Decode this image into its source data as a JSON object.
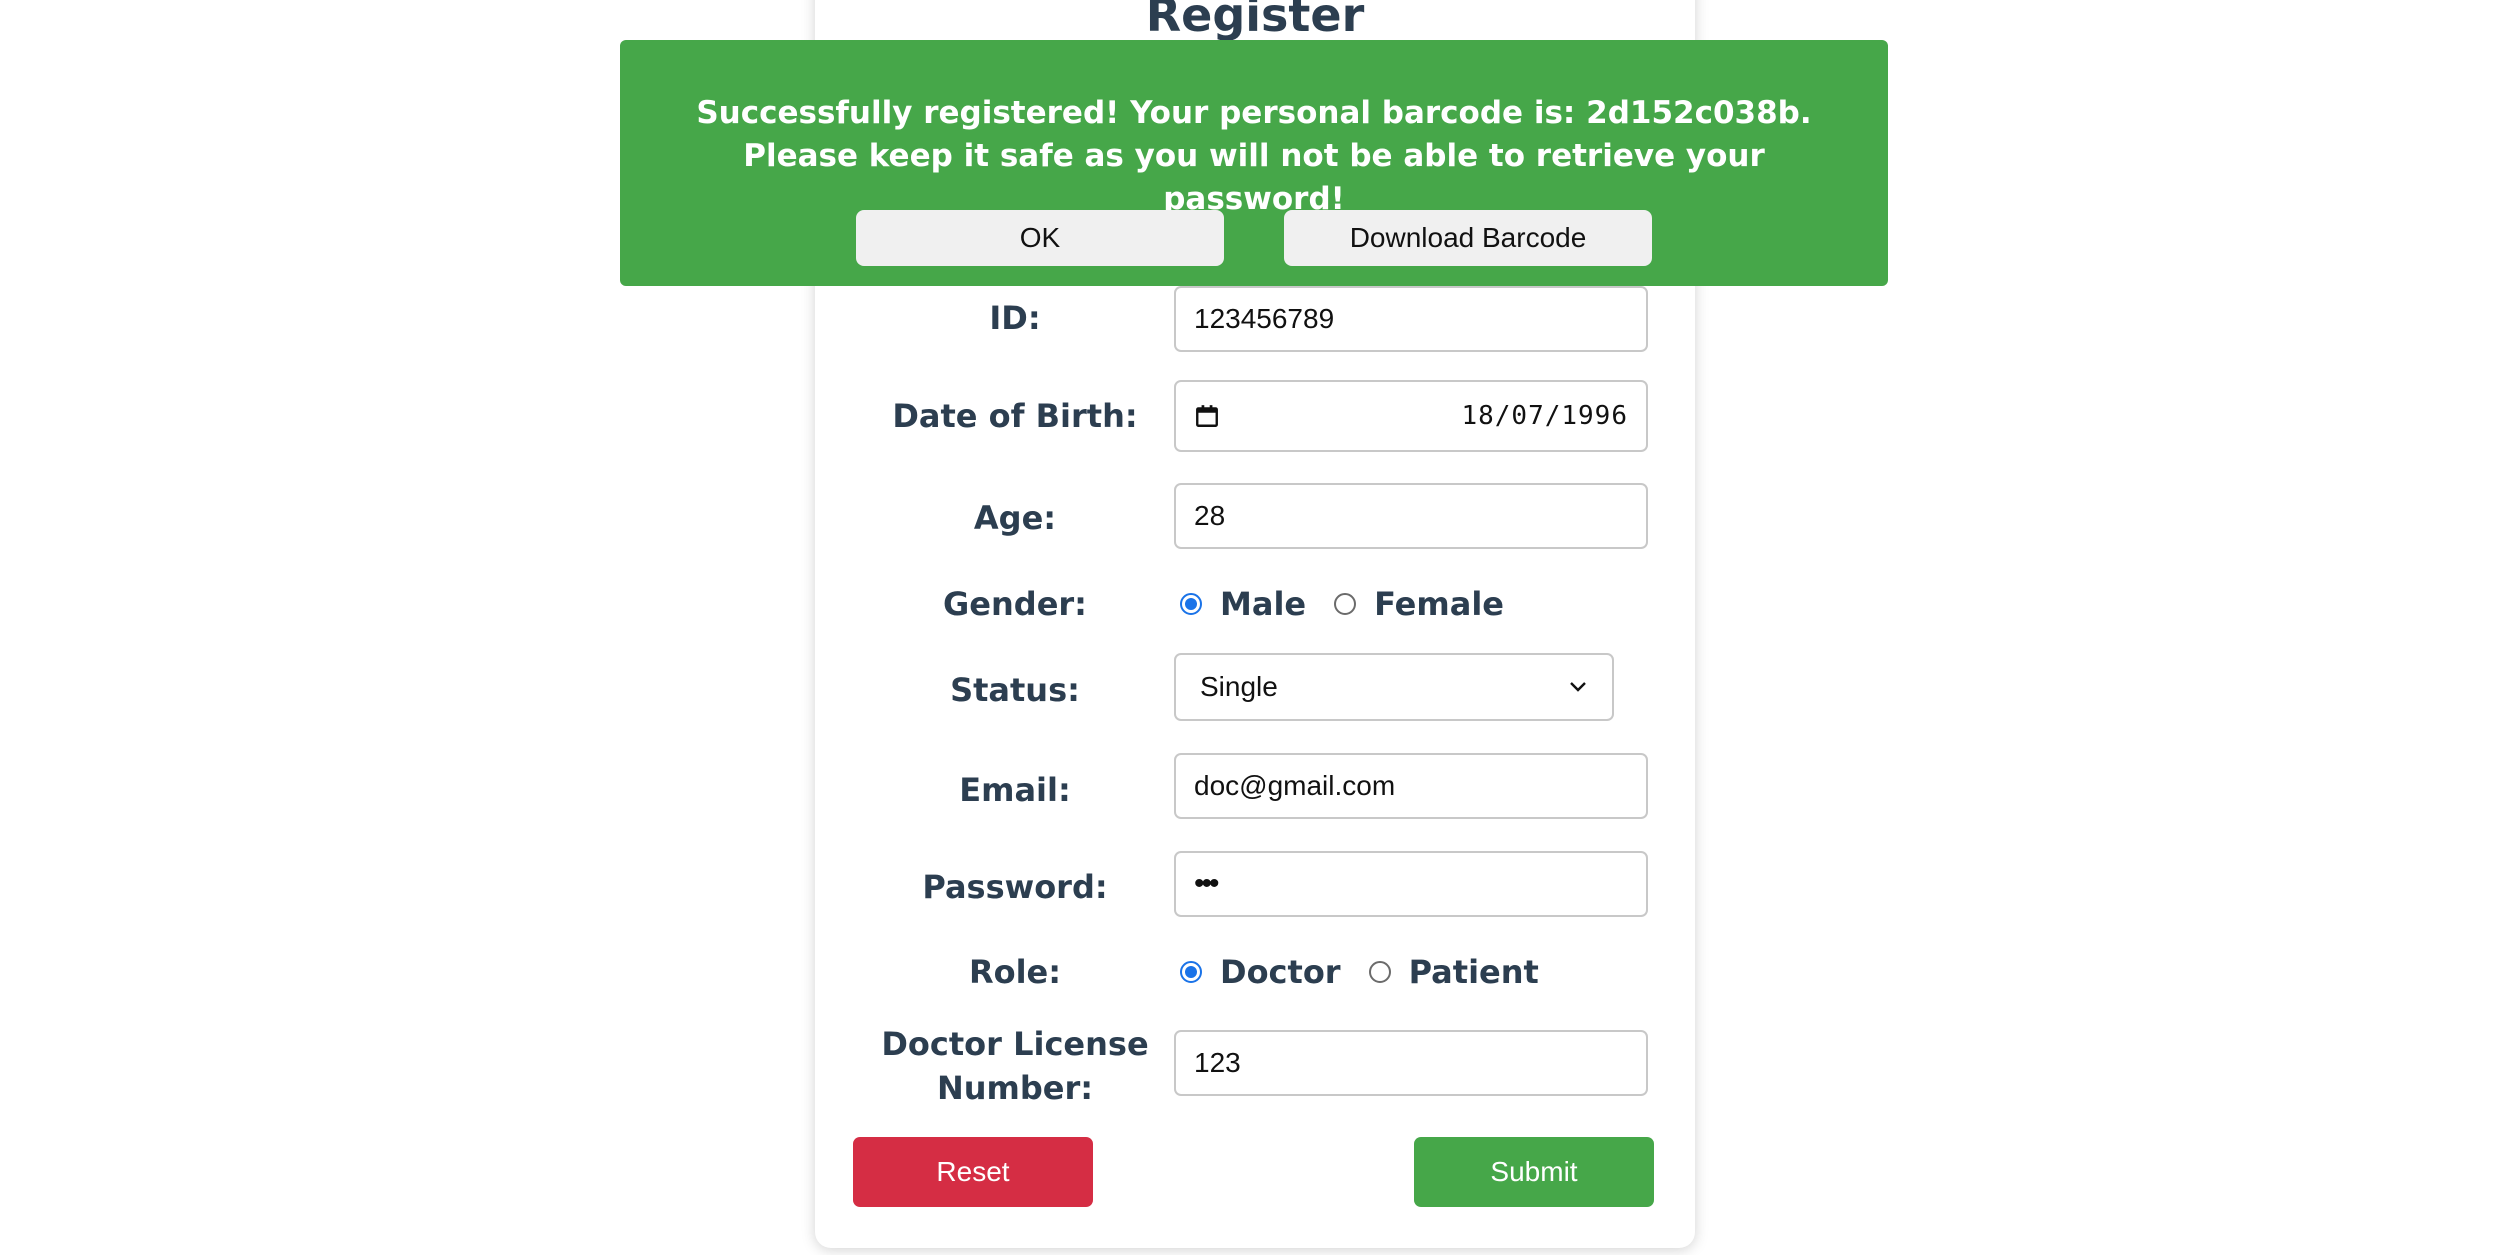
{
  "form": {
    "title": "Register",
    "fields": {
      "id": {
        "label": "ID:",
        "value": "123456789"
      },
      "dob": {
        "label": "Date of Birth:",
        "value": "18/07/1996"
      },
      "age": {
        "label": "Age:",
        "value": "28"
      },
      "gender": {
        "label": "Gender:",
        "options": [
          "Male",
          "Female"
        ],
        "selected": "Male"
      },
      "status": {
        "label": "Status:",
        "value": "Single"
      },
      "email": {
        "label": "Email:",
        "value": "doc@gmail.com"
      },
      "password": {
        "label": "Password:",
        "masked": "•••"
      },
      "role": {
        "label": "Role:",
        "options": [
          "Doctor",
          "Patient"
        ],
        "selected": "Doctor"
      },
      "license": {
        "label": "Doctor License Number:",
        "value": "123"
      }
    },
    "buttons": {
      "reset": "Reset",
      "submit": "Submit"
    }
  },
  "toast": {
    "message": "Successfully registered! Your personal barcode is: 2d152c038b. Please keep it safe as you will not be able to retrieve your password!",
    "ok_label": "OK",
    "download_label": "Download Barcode"
  },
  "colors": {
    "success": "#46a749",
    "danger": "#d52d44",
    "text": "#2c3e50",
    "radio_checked": "#1a73e8"
  },
  "icons": {
    "date": "calendar-icon",
    "select": "chevron-down-icon"
  }
}
